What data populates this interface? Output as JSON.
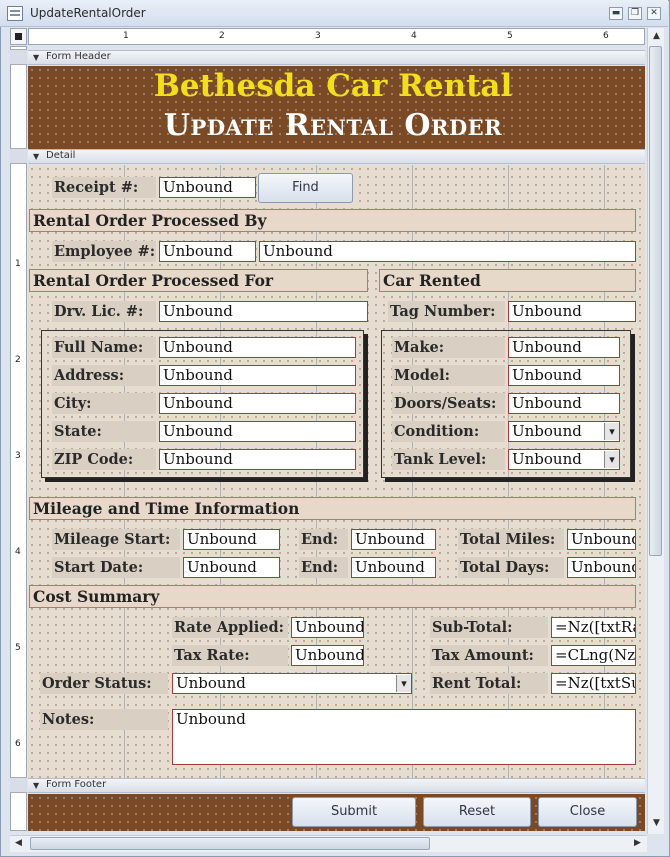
{
  "window": {
    "title": "UpdateRentalOrder",
    "min": "▬",
    "restore": "❐",
    "close": "✕"
  },
  "ruler": {
    "h_ticks": [
      "1",
      "2",
      "3",
      "4",
      "5",
      "6"
    ],
    "v_ticks": [
      "1",
      "2",
      "3",
      "4",
      "5",
      "6"
    ]
  },
  "sections": {
    "header": "Form Header",
    "detail": "Detail",
    "footer": "Form Footer"
  },
  "header": {
    "company": "Bethesda Car Rental",
    "title": "Update Rental Order"
  },
  "receipt": {
    "label": "Receipt #:",
    "value": "Unbound",
    "find_button": "Find"
  },
  "processed_by": {
    "heading": "Rental Order Processed By",
    "employee_label": "Employee #:",
    "employee_value": "Unbound",
    "employee_name": "Unbound"
  },
  "processed_for": {
    "heading": "Rental Order Processed For",
    "drv_label": "Drv. Lic. #:",
    "drv_value": "Unbound",
    "fields": [
      {
        "label": "Full Name:",
        "value": "Unbound"
      },
      {
        "label": "Address:",
        "value": "Unbound"
      },
      {
        "label": "City:",
        "value": "Unbound"
      },
      {
        "label": "State:",
        "value": "Unbound"
      },
      {
        "label": "ZIP Code:",
        "value": "Unbound"
      }
    ]
  },
  "car": {
    "heading": "Car Rented",
    "tag_label": "Tag Number:",
    "tag_value": "Unbound",
    "fields": [
      {
        "label": "Make:",
        "value": "Unbound"
      },
      {
        "label": "Model:",
        "value": "Unbound"
      },
      {
        "label": "Doors/Seats:",
        "value": "Unbound"
      },
      {
        "label": "Condition:",
        "value": "Unbound"
      },
      {
        "label": "Tank Level:",
        "value": "Unbound"
      }
    ]
  },
  "mileage": {
    "heading": "Mileage and Time Information",
    "mileage_start_label": "Mileage Start:",
    "mileage_start_value": "Unbound",
    "end_label": "End:",
    "end_value": "Unbound",
    "total_miles_label": "Total Miles:",
    "total_miles_value": "Unbound",
    "start_date_label": "Start Date:",
    "start_date_value": "Unbound",
    "end_date_label": "End:",
    "end_date_value": "Unbound",
    "total_days_label": "Total Days:",
    "total_days_value": "Unbound"
  },
  "cost": {
    "heading": "Cost Summary",
    "rate_label": "Rate Applied:",
    "rate_value": "Unbound",
    "tax_rate_label": "Tax Rate:",
    "tax_rate_value": "Unbound",
    "subtotal_label": "Sub-Total:",
    "subtotal_value": "=Nz([txtRa",
    "tax_amount_label": "Tax Amount:",
    "tax_amount_value": "=CLng(Nz(",
    "rent_total_label": "Rent Total:",
    "rent_total_value": "=Nz([txtSu",
    "order_status_label": "Order Status:",
    "order_status_value": "Unbound"
  },
  "notes": {
    "label": "Notes:",
    "value": "Unbound"
  },
  "footer": {
    "submit": "Submit",
    "reset": "Reset",
    "close": "Close"
  }
}
